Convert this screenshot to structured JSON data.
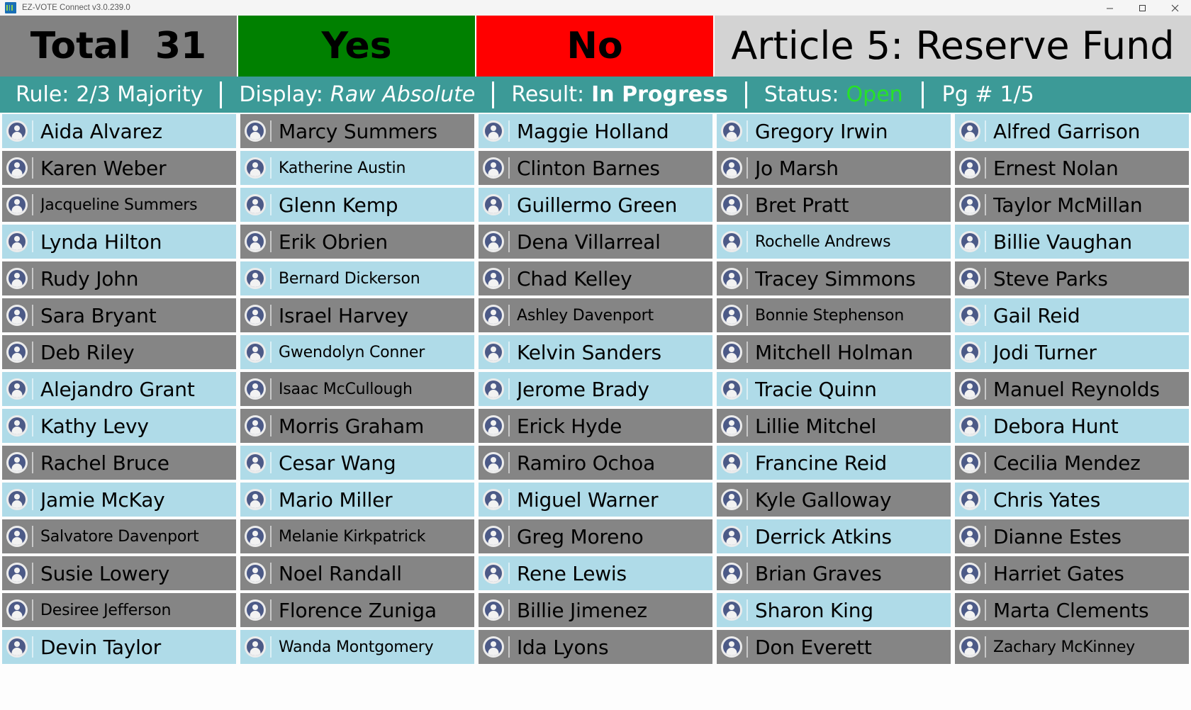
{
  "window": {
    "title": "EZ-VOTE Connect v3.0.239.0",
    "app_icon": "ez-vote-logo-icon",
    "minimize": "minimize-icon",
    "maximize": "maximize-icon",
    "close": "close-icon"
  },
  "tally": {
    "total_label": "Total",
    "total_count": "31",
    "yes_label": "Yes",
    "yes_count": "",
    "no_label": "No",
    "no_count": "",
    "motion_title": "Article 5: Reserve Fund",
    "colors": {
      "total_bg": "#828282",
      "yes_bg": "#008000",
      "no_bg": "#ff0000",
      "title_bg": "#d3d3d3"
    }
  },
  "status": {
    "bg": "#3c9a97",
    "rule_label": "Rule:",
    "rule_value": "2/3 Majority",
    "display_label": "Display:",
    "display_value": "Raw Absolute",
    "result_label": "Result:",
    "result_value": "In Progress",
    "status_label": "Status:",
    "status_value": "Open",
    "status_value_color": "#27e227",
    "page_label": "Pg #",
    "page_value": "1/5"
  },
  "grid": {
    "voted_bg": "#afdbe8",
    "unvoted_bg": "#858585",
    "columns": [
      {
        "name": "participant-column-1",
        "cells": [
          {
            "name": "Aida Alvarez",
            "voted": true
          },
          {
            "name": "Karen Weber",
            "voted": false
          },
          {
            "name": "Jacqueline Summers",
            "voted": false
          },
          {
            "name": "Lynda Hilton",
            "voted": true
          },
          {
            "name": "Rudy John",
            "voted": false
          },
          {
            "name": "Sara Bryant",
            "voted": false
          },
          {
            "name": "Deb Riley",
            "voted": false
          },
          {
            "name": "Alejandro Grant",
            "voted": true
          },
          {
            "name": "Kathy Levy",
            "voted": true
          },
          {
            "name": "Rachel Bruce",
            "voted": false
          },
          {
            "name": "Jamie McKay",
            "voted": true
          },
          {
            "name": "Salvatore Davenport",
            "voted": false
          },
          {
            "name": "Susie Lowery",
            "voted": false
          },
          {
            "name": "Desiree Jefferson",
            "voted": false
          },
          {
            "name": "Devin Taylor",
            "voted": true
          }
        ]
      },
      {
        "name": "participant-column-2",
        "cells": [
          {
            "name": "Marcy Summers",
            "voted": false
          },
          {
            "name": "Katherine Austin",
            "voted": true
          },
          {
            "name": "Glenn Kemp",
            "voted": true
          },
          {
            "name": "Erik Obrien",
            "voted": false
          },
          {
            "name": "Bernard Dickerson",
            "voted": true
          },
          {
            "name": "Israel Harvey",
            "voted": false
          },
          {
            "name": "Gwendolyn Conner",
            "voted": true
          },
          {
            "name": "Isaac McCullough",
            "voted": false
          },
          {
            "name": "Morris Graham",
            "voted": false
          },
          {
            "name": "Cesar Wang",
            "voted": true
          },
          {
            "name": "Mario Miller",
            "voted": true
          },
          {
            "name": "Melanie Kirkpatrick",
            "voted": false
          },
          {
            "name": "Noel Randall",
            "voted": false
          },
          {
            "name": "Florence Zuniga",
            "voted": false
          },
          {
            "name": "Wanda Montgomery",
            "voted": true
          }
        ]
      },
      {
        "name": "participant-column-3",
        "cells": [
          {
            "name": "Maggie Holland",
            "voted": true
          },
          {
            "name": "Clinton Barnes",
            "voted": false
          },
          {
            "name": "Guillermo Green",
            "voted": true
          },
          {
            "name": "Dena Villarreal",
            "voted": false
          },
          {
            "name": "Chad Kelley",
            "voted": false
          },
          {
            "name": "Ashley Davenport",
            "voted": false
          },
          {
            "name": "Kelvin Sanders",
            "voted": true
          },
          {
            "name": "Jerome Brady",
            "voted": true
          },
          {
            "name": "Erick Hyde",
            "voted": false
          },
          {
            "name": "Ramiro Ochoa",
            "voted": false
          },
          {
            "name": "Miguel Warner",
            "voted": true
          },
          {
            "name": "Greg Moreno",
            "voted": false
          },
          {
            "name": "Rene Lewis",
            "voted": true
          },
          {
            "name": "Billie Jimenez",
            "voted": false
          },
          {
            "name": "Ida Lyons",
            "voted": false
          }
        ]
      },
      {
        "name": "participant-column-4",
        "cells": [
          {
            "name": "Gregory Irwin",
            "voted": true
          },
          {
            "name": "Jo Marsh",
            "voted": false
          },
          {
            "name": "Bret Pratt",
            "voted": false
          },
          {
            "name": "Rochelle Andrews",
            "voted": true
          },
          {
            "name": "Tracey Simmons",
            "voted": false
          },
          {
            "name": "Bonnie Stephenson",
            "voted": false
          },
          {
            "name": "Mitchell Holman",
            "voted": false
          },
          {
            "name": "Tracie Quinn",
            "voted": true
          },
          {
            "name": "Lillie Mitchel",
            "voted": false
          },
          {
            "name": "Francine Reid",
            "voted": true
          },
          {
            "name": "Kyle Galloway",
            "voted": false
          },
          {
            "name": "Derrick Atkins",
            "voted": true
          },
          {
            "name": "Brian Graves",
            "voted": false
          },
          {
            "name": "Sharon King",
            "voted": true
          },
          {
            "name": "Don Everett",
            "voted": false
          }
        ]
      },
      {
        "name": "participant-column-5",
        "cells": [
          {
            "name": "Alfred Garrison",
            "voted": true
          },
          {
            "name": "Ernest Nolan",
            "voted": false
          },
          {
            "name": "Taylor McMillan",
            "voted": false
          },
          {
            "name": "Billie Vaughan",
            "voted": true
          },
          {
            "name": "Steve Parks",
            "voted": false
          },
          {
            "name": "Gail Reid",
            "voted": true
          },
          {
            "name": "Jodi Turner",
            "voted": true
          },
          {
            "name": "Manuel Reynolds",
            "voted": false
          },
          {
            "name": "Debora Hunt",
            "voted": true
          },
          {
            "name": "Cecilia Mendez",
            "voted": false
          },
          {
            "name": "Chris Yates",
            "voted": true
          },
          {
            "name": "Dianne Estes",
            "voted": false
          },
          {
            "name": "Harriet Gates",
            "voted": false
          },
          {
            "name": "Marta Clements",
            "voted": false
          },
          {
            "name": "Zachary McKinney",
            "voted": false
          }
        ]
      }
    ]
  }
}
